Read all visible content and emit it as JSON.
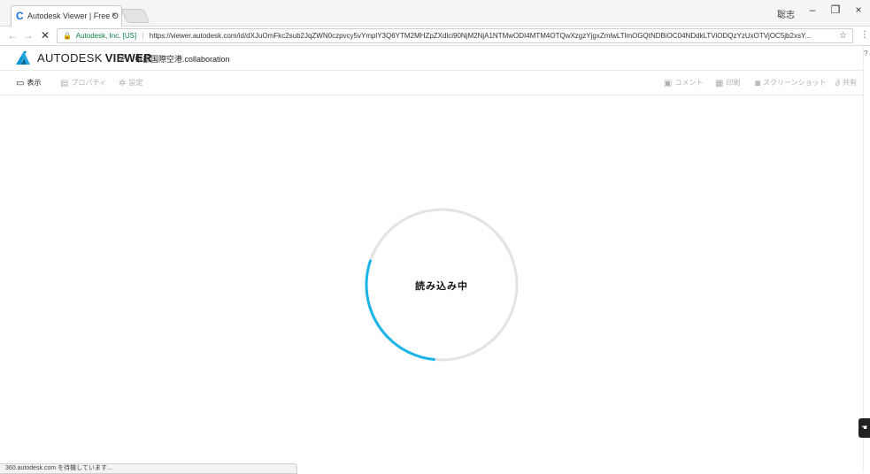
{
  "browser": {
    "tab_title": "Autodesk Viewer | Free O",
    "tab_close": "×",
    "window_user": "聡志",
    "window_minimize": "–",
    "window_restore": "❐",
    "window_close": "×"
  },
  "address_bar": {
    "back": "←",
    "forward": "→",
    "stop": "✕",
    "secure_label": "Autodesk, Inc. [US]",
    "separator": "|",
    "url": "https://viewer.autodesk.com/id/dXJuOmFkc2sub2JqZWN0czpvcy5vYmplY3Q6YTM2MHZpZXdlci90NjM2NjA1NTMwODI4MTM4OTQwXzgzYjgxZmlwLTlmOGQtNDBiOC04NDdkLTViODQzYzUxOTVjOC5jb2xsY...",
    "bookmark": "☆",
    "menu": "⋮"
  },
  "viewer_header": {
    "brand_primary": "AUTODESK",
    "brand_secondary": "VIEWER",
    "breadcrumb_chevron": ">",
    "filename": "中部国際空港.collaboration",
    "brand_color": "#0696d7"
  },
  "toolbar": {
    "view_label": "表示",
    "properties_label": "プロパティ",
    "settings_label": "設定",
    "comment_label": "コメント",
    "print_label": "印刷",
    "screenshot_label": "スクリーンショット",
    "share_label": "共有"
  },
  "loading": {
    "text": "読み込み中",
    "progress": 0.29,
    "arc_color": "#1ab4e6",
    "track_color": "#e3e3e3"
  },
  "status": {
    "text": "360.autodesk.com を待機しています..."
  },
  "side": {
    "rail_mark": "?",
    "feedback_icon": "☚"
  }
}
